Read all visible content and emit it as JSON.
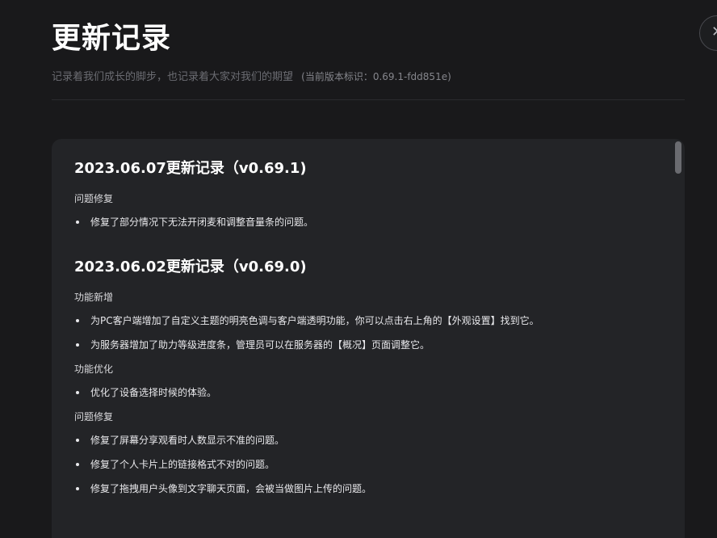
{
  "header": {
    "title": "更新记录",
    "subtitle": "记录着我们成长的脚步，也记录着大家对我们的期望",
    "version_label": "(当前版本标识：0.69.1-fdd851e)",
    "close_icon": "close-icon"
  },
  "releases": [
    {
      "title": "2023.06.07更新记录（v0.69.1)",
      "sections": [
        {
          "heading": "问题修复",
          "items": [
            "修复了部分情况下无法开闭麦和调整音量条的问题。"
          ]
        }
      ]
    },
    {
      "title": "2023.06.02更新记录（v0.69.0)",
      "sections": [
        {
          "heading": "功能新增",
          "items": [
            "为PC客户端增加了自定义主题的明亮色调与客户端透明功能，你可以点击右上角的【外观设置】找到它。",
            "为服务器增加了助力等级进度条，管理员可以在服务器的【概况】页面调整它。"
          ]
        },
        {
          "heading": "功能优化",
          "items": [
            "优化了设备选择时候的体验。"
          ]
        },
        {
          "heading": "问题修复",
          "items": [
            "修复了屏幕分享观看时人数显示不准的问题。",
            "修复了个人卡片上的链接格式不对的问题。",
            "修复了拖拽用户头像到文字聊天页面，会被当做图片上传的问题。"
          ]
        }
      ]
    }
  ]
}
